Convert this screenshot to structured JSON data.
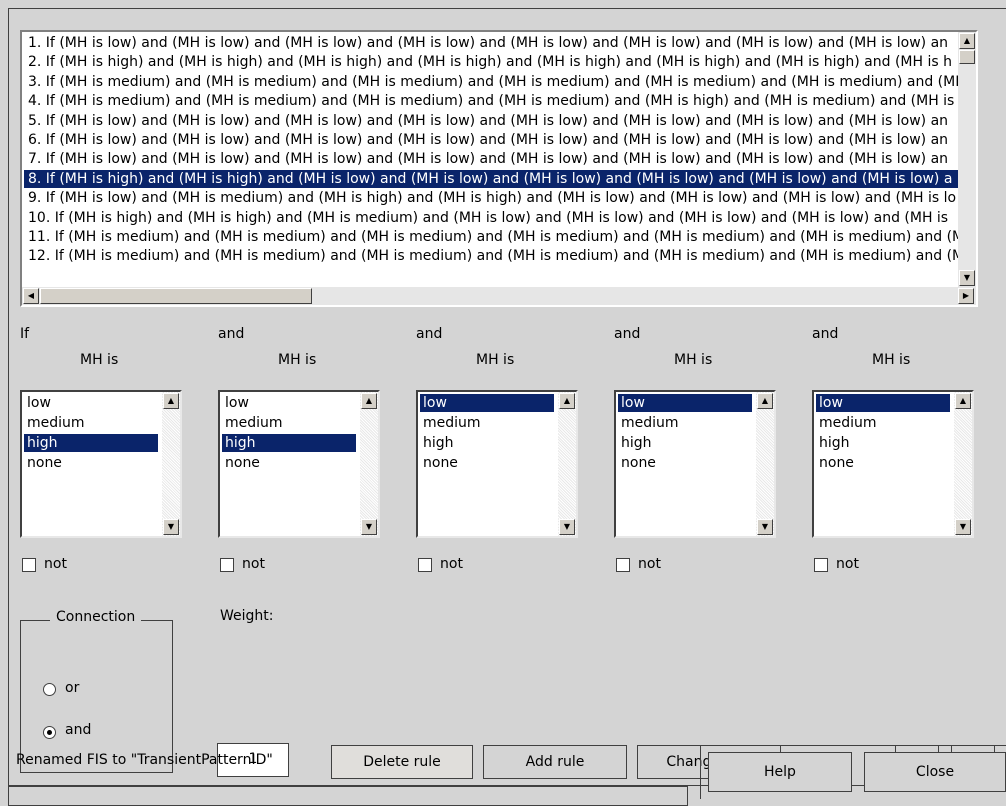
{
  "rules": [
    "1. If (MH is low) and (MH is low) and (MH is low) and (MH is low) and (MH is low) and (MH is low) and (MH is low) and (MH is low) an",
    "2. If (MH is high) and (MH is high) and (MH is high) and (MH is high) and (MH is high) and (MH is high) and (MH is high) and (MH is h",
    "3. If (MH is medium) and (MH is medium) and (MH is medium) and (MH is medium) and (MH is medium) and (MH is medium) and (MH",
    "4. If (MH is medium) and (MH is medium) and (MH is medium) and (MH is medium) and (MH is high) and (MH is medium) and (MH is m",
    "5. If (MH is low) and (MH is low) and (MH is low) and (MH is low) and (MH is low) and (MH is low) and (MH is low) and (MH is low) an",
    "6. If (MH is low) and (MH is low) and (MH is low) and (MH is low) and (MH is low) and (MH is low) and (MH is low) and (MH is low) an",
    "7. If (MH is low) and (MH is low) and (MH is low) and (MH is low) and (MH is low) and (MH is low) and (MH is low) and (MH is low) an",
    "8. If (MH is high) and (MH is high) and (MH is low) and (MH is low) and (MH is low) and (MH is low) and (MH is low) and (MH is low) a",
    "9. If (MH is low) and (MH is medium) and (MH is high) and (MH is high) and (MH is low) and (MH is low) and (MH is low) and (MH is lo",
    "10. If (MH is high) and (MH is high) and (MH is medium) and (MH is low) and (MH is low) and (MH is low) and (MH is low) and (MH is",
    "11. If (MH is medium) and (MH is medium) and (MH is medium) and (MH is medium) and (MH is medium) and (MH is medium) and (MH",
    "12. If (MH is medium) and (MH is medium) and (MH is medium) and (MH is medium) and (MH is medium) and (MH is medium) and (MH"
  ],
  "selected_rule_index": 7,
  "antecedents": [
    {
      "connector": "If",
      "variable": "MH is",
      "options": [
        "low",
        "medium",
        "high",
        "none"
      ],
      "selected": 2,
      "not_label": "not"
    },
    {
      "connector": "and",
      "variable": "MH is",
      "options": [
        "low",
        "medium",
        "high",
        "none"
      ],
      "selected": 2,
      "not_label": "not"
    },
    {
      "connector": "and",
      "variable": "MH is",
      "options": [
        "low",
        "medium",
        "high",
        "none"
      ],
      "selected": 0,
      "not_label": "not"
    },
    {
      "connector": "and",
      "variable": "MH is",
      "options": [
        "low",
        "medium",
        "high",
        "none"
      ],
      "selected": 0,
      "not_label": "not"
    },
    {
      "connector": "and",
      "variable": "MH is",
      "options": [
        "low",
        "medium",
        "high",
        "none"
      ],
      "selected": 0,
      "not_label": "not"
    }
  ],
  "connection": {
    "title": "Connection",
    "or_label": "or",
    "and_label": "and",
    "selected": "and"
  },
  "weight": {
    "label": "Weight:",
    "value": "1"
  },
  "buttons": {
    "delete": "Delete rule",
    "add": "Add rule",
    "change": "Change rule",
    "prev": "<<",
    "next": ">>",
    "help": "Help",
    "close": "Close"
  },
  "status": "Renamed FIS to \"TransientPatternID\""
}
